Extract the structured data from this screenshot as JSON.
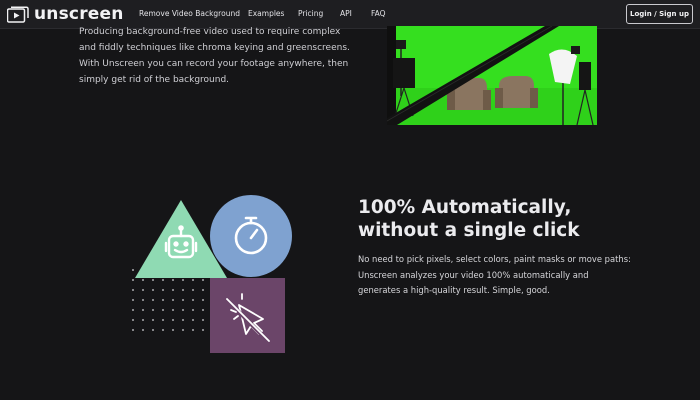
{
  "header": {
    "logo_text": "unscreen",
    "nav": [
      {
        "label": "Remove Video Background"
      },
      {
        "label": "Examples"
      },
      {
        "label": "Pricing"
      },
      {
        "label": "API"
      },
      {
        "label": "FAQ"
      }
    ],
    "login_label": "Login / Sign up"
  },
  "intro": {
    "text": "Producing background-free video used to require complex and fiddly techniques like chroma keying and greenscreens. With Unscreen you can record your footage anywhere, then simply get rid of the background."
  },
  "feature": {
    "title_line1": "100% Automatically,",
    "title_line2": "without a single click",
    "body": "No need to pick pixels, select colors, paint masks or move paths: Unscreen analyzes your video 100% automatically and generates a high-quality result. Simple, good."
  },
  "colors": {
    "background": "#151517",
    "header": "#1e1e21",
    "triangle": "#8fdab3",
    "circle": "#7fa2d0",
    "square": "#6b4569",
    "greenscreen": "#33e01e"
  },
  "icons": [
    "play-window-logo-icon",
    "robot-icon",
    "stopwatch-icon",
    "cursor-slash-icon"
  ]
}
